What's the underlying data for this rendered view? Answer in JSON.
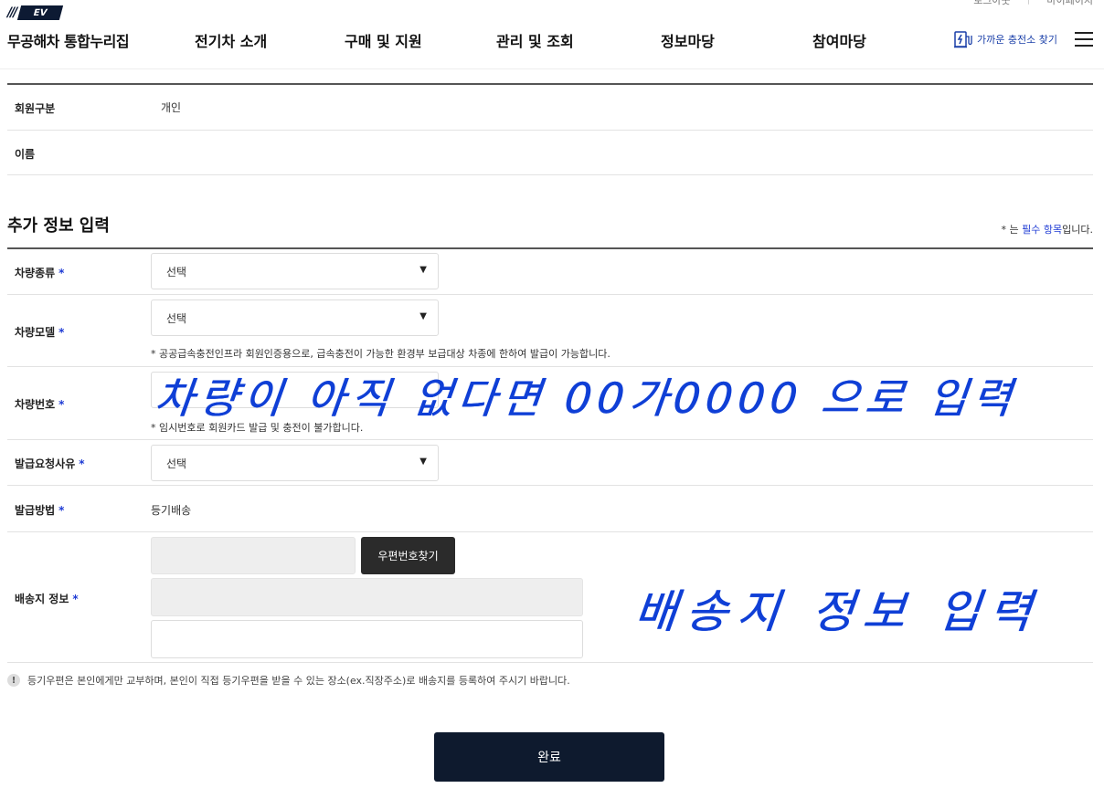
{
  "header": {
    "util_links": [
      "로그아웃",
      "마이페이지"
    ],
    "logo_badge": "EV",
    "site_title": "무공해차 통합누리집",
    "menus": [
      "전기차 소개",
      "구매 및 지원",
      "관리 및 조회",
      "정보마당",
      "참여마당"
    ],
    "charger_link": "가까운 충전소 찾기"
  },
  "member": {
    "rows": [
      {
        "label": "회원구분",
        "value": "개인"
      },
      {
        "label": "이름",
        "value": ""
      }
    ]
  },
  "section": {
    "title": "추가 정보 입력",
    "req_note_prefix": "* 는 ",
    "req_note_highlight": "필수 항목",
    "req_note_suffix": "입니다."
  },
  "form": {
    "required_mark": "*",
    "vehicle_type": {
      "label": "차량종류",
      "value": "선택"
    },
    "vehicle_model": {
      "label": "차량모델",
      "value": "선택",
      "hint": "* 공공급속충전인프라 회원인증용으로, 급속충전이 가능한 환경부 보급대상 차종에 한하여 발급이 가능합니다."
    },
    "vehicle_number": {
      "label": "차량번호",
      "hint": "* 임시번호로 회원카드 발급 및 충전이 불가합니다."
    },
    "issue_reason": {
      "label": "발급요청사유",
      "value": "선택"
    },
    "issue_method": {
      "label": "발급방법",
      "value": "등기배송"
    },
    "shipping": {
      "label": "배송지 정보",
      "zip_button": "우편번호찾기"
    }
  },
  "notice": {
    "icon": "!",
    "text": "등기우편은 본인에게만 교부하며, 본인이 직접 등기우편을 받을 수 있는 장소(ex.직장주소)로 배송지를 등록하여 주시기 바랍니다."
  },
  "submit_label": "완료",
  "annotations": {
    "vehicle_number_note": "차량이 아직 없다면 00가0000 으로 입력",
    "shipping_note": "배송지 정보 입력"
  },
  "colors": {
    "accent": "#1e3bd4",
    "navy": "#0e1a2e",
    "handwriting": "#0f3fd6"
  }
}
